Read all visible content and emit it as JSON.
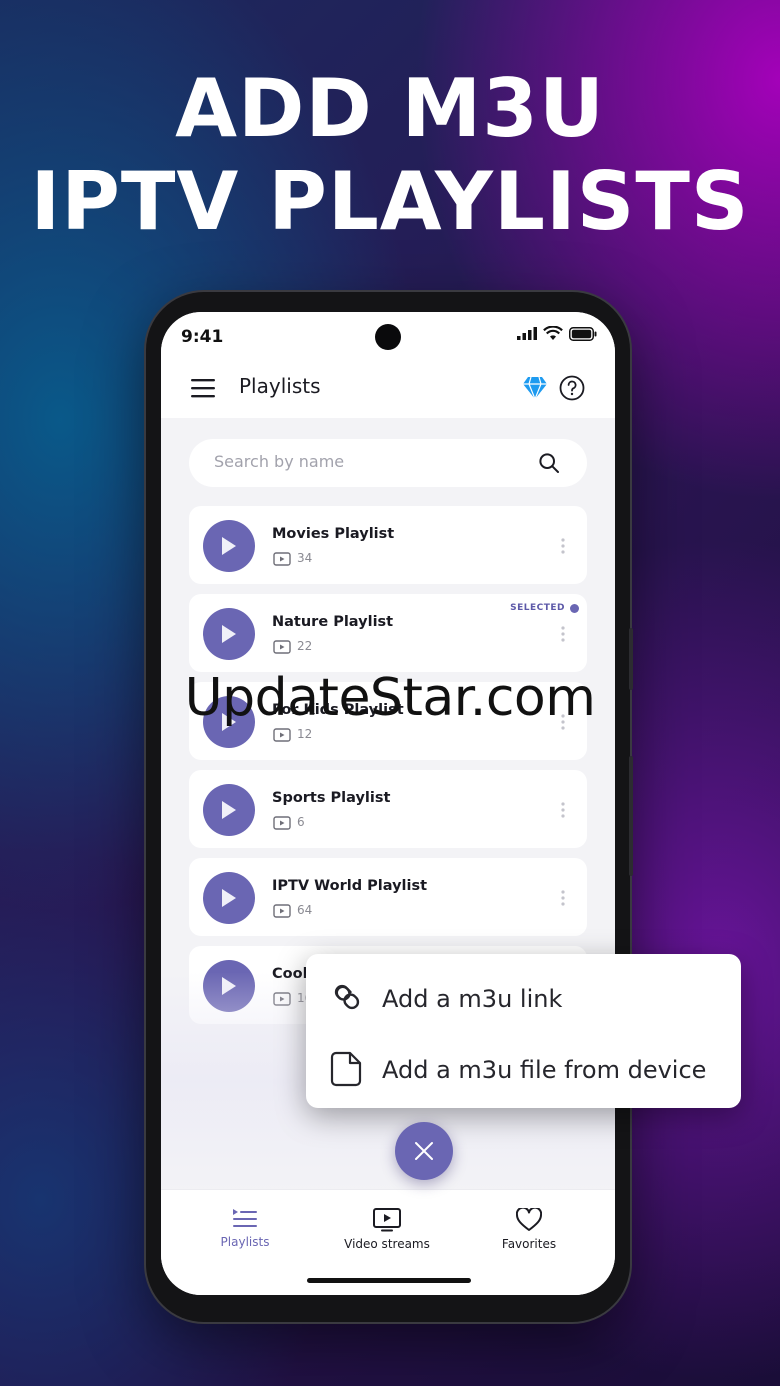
{
  "headline": {
    "line1": "ADD M3U",
    "line2": "IPTV PLAYLISTS"
  },
  "status": {
    "time": "9:41"
  },
  "appbar": {
    "title": "Playlists"
  },
  "search": {
    "placeholder": "Search by name"
  },
  "playlists": [
    {
      "name": "Movies Playlist",
      "count": "34",
      "selected": false
    },
    {
      "name": "Nature Playlist",
      "count": "22",
      "selected": true,
      "selected_label": "SELECTED"
    },
    {
      "name": "For Kids Playlist",
      "count": "12",
      "selected": false
    },
    {
      "name": "Sports Playlist",
      "count": "6",
      "selected": false
    },
    {
      "name": "IPTV World Playlist",
      "count": "64",
      "selected": false
    },
    {
      "name": "Cook",
      "count": "16",
      "selected": false
    }
  ],
  "add_menu": {
    "items": [
      {
        "label": "Add a m3u link",
        "icon": "link-icon"
      },
      {
        "label": "Add a m3u file from device",
        "icon": "file-icon"
      }
    ]
  },
  "bottom_nav": {
    "items": [
      {
        "label": "Playlists",
        "icon": "playlist-icon",
        "active": true
      },
      {
        "label": "Video streams",
        "icon": "tv-play-icon",
        "active": false
      },
      {
        "label": "Favorites",
        "icon": "heart-icon",
        "active": false
      }
    ]
  },
  "watermark": "UpdateStar.com",
  "colors": {
    "accent": "#6a66b3",
    "premium": "#1e9bf0"
  }
}
